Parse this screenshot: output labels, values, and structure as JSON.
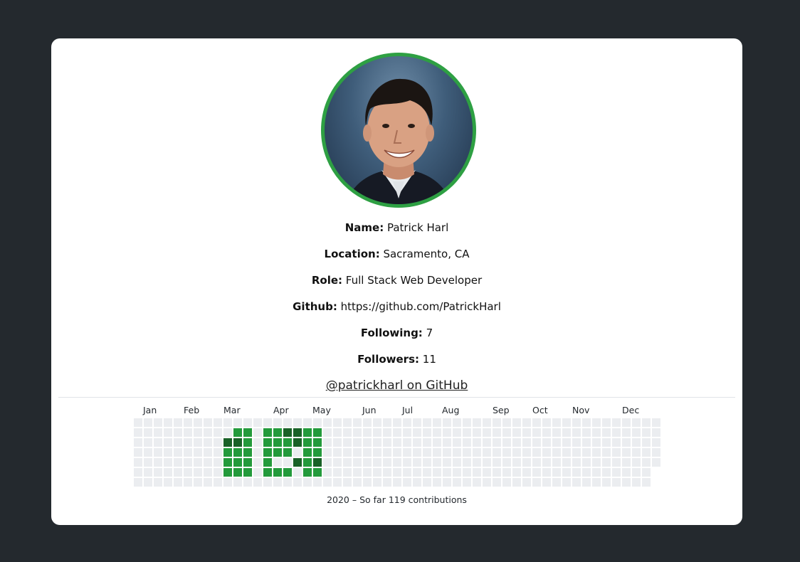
{
  "profile": {
    "avatar_alt": "profile-photo",
    "fields": [
      {
        "label": "Name:",
        "value": "Patrick Harl"
      },
      {
        "label": "Location:",
        "value": "Sacramento, CA"
      },
      {
        "label": "Role:",
        "value": "Full Stack Web Developer"
      },
      {
        "label": "Github:",
        "value": "https://github.com/PatrickHarl"
      },
      {
        "label": "Following:",
        "value": "7"
      },
      {
        "label": "Followers:",
        "value": "11"
      }
    ],
    "github_link": "@patrickharl on GitHub"
  },
  "contributions": {
    "months": [
      "Jan",
      "Feb",
      "Mar",
      "Apr",
      "May",
      "Jun",
      "Jul",
      "Aug",
      "Sep",
      "Oct",
      "Nov",
      "Dec"
    ],
    "summary": "2020 – So far 119 contributions",
    "colors": {
      "empty": "#ebedf0",
      "level2": "#239a3b",
      "level4": "#196127",
      "border": "#2ea043",
      "page_bg": "#24292e"
    },
    "active_cells": [
      {
        "week": 10,
        "day": 1,
        "level": 2
      },
      {
        "week": 11,
        "day": 1,
        "level": 2
      },
      {
        "week": 13,
        "day": 1,
        "level": 2
      },
      {
        "week": 14,
        "day": 1,
        "level": 2
      },
      {
        "week": 15,
        "day": 1,
        "level": 4
      },
      {
        "week": 16,
        "day": 1,
        "level": 4
      },
      {
        "week": 17,
        "day": 1,
        "level": 2
      },
      {
        "week": 18,
        "day": 1,
        "level": 2
      },
      {
        "week": 9,
        "day": 2,
        "level": 4
      },
      {
        "week": 10,
        "day": 2,
        "level": 4
      },
      {
        "week": 11,
        "day": 2,
        "level": 2
      },
      {
        "week": 13,
        "day": 2,
        "level": 2
      },
      {
        "week": 14,
        "day": 2,
        "level": 2
      },
      {
        "week": 15,
        "day": 2,
        "level": 2
      },
      {
        "week": 16,
        "day": 2,
        "level": 4
      },
      {
        "week": 17,
        "day": 2,
        "level": 2
      },
      {
        "week": 18,
        "day": 2,
        "level": 2
      },
      {
        "week": 9,
        "day": 3,
        "level": 2
      },
      {
        "week": 10,
        "day": 3,
        "level": 2
      },
      {
        "week": 11,
        "day": 3,
        "level": 2
      },
      {
        "week": 13,
        "day": 3,
        "level": 2
      },
      {
        "week": 14,
        "day": 3,
        "level": 2
      },
      {
        "week": 15,
        "day": 3,
        "level": 2
      },
      {
        "week": 17,
        "day": 3,
        "level": 2
      },
      {
        "week": 18,
        "day": 3,
        "level": 2
      },
      {
        "week": 9,
        "day": 4,
        "level": 2
      },
      {
        "week": 10,
        "day": 4,
        "level": 2
      },
      {
        "week": 11,
        "day": 4,
        "level": 2
      },
      {
        "week": 13,
        "day": 4,
        "level": 2
      },
      {
        "week": 16,
        "day": 4,
        "level": 4
      },
      {
        "week": 17,
        "day": 4,
        "level": 2
      },
      {
        "week": 18,
        "day": 4,
        "level": 4
      },
      {
        "week": 9,
        "day": 5,
        "level": 2
      },
      {
        "week": 10,
        "day": 5,
        "level": 2
      },
      {
        "week": 11,
        "day": 5,
        "level": 2
      },
      {
        "week": 13,
        "day": 5,
        "level": 2
      },
      {
        "week": 14,
        "day": 5,
        "level": 2
      },
      {
        "week": 15,
        "day": 5,
        "level": 2
      },
      {
        "week": 17,
        "day": 5,
        "level": 2
      },
      {
        "week": 18,
        "day": 5,
        "level": 2
      }
    ]
  }
}
